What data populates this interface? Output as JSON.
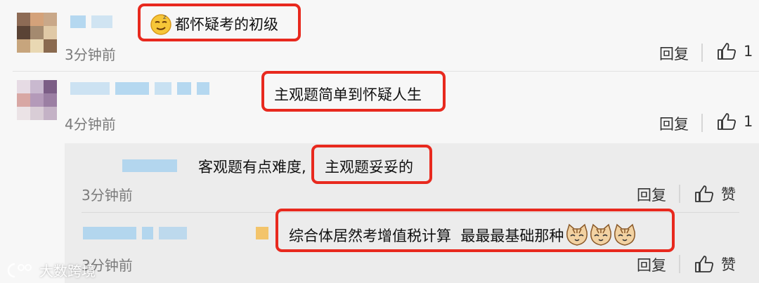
{
  "comments": [
    {
      "text": "都怀疑考的初级",
      "time": "3分钟前",
      "reply_label": "回复",
      "like_count": "1"
    },
    {
      "text": "主观题简单到怀疑人生",
      "time": "4分钟前",
      "reply_label": "回复",
      "like_count": "1",
      "replies": [
        {
          "prefix_text": "客观题有点难度,",
          "highlight_text": "主观题妥妥的",
          "time": "3分钟前",
          "reply_label": "回复",
          "like_label": "赞"
        },
        {
          "text": "综合体居然考增值税计算  最最最基础那种",
          "time": "3分钟前",
          "reply_label": "回复",
          "like_label": "赞"
        }
      ]
    }
  ],
  "watermark": {
    "text": "大数跨境"
  },
  "colors": {
    "highlight": "#e8291e",
    "name_blur": "#a9d2ee",
    "timestamp": "#7b7b7b",
    "background": "#f7f7f7",
    "reply_background": "#ececec"
  }
}
